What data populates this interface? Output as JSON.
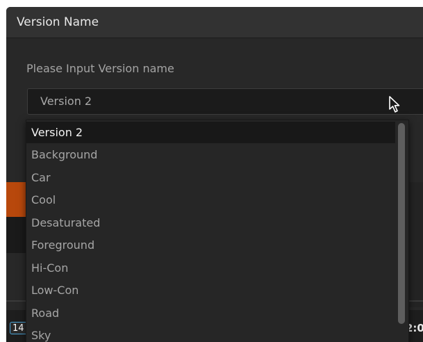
{
  "dialog": {
    "title": "Version Name",
    "prompt": "Please Input Version name",
    "combo_value": "Version 2"
  },
  "dropdown": {
    "items": [
      {
        "label": "Version 2",
        "selected": true
      },
      {
        "label": "Background",
        "selected": false
      },
      {
        "label": "Car",
        "selected": false
      },
      {
        "label": "Cool",
        "selected": false
      },
      {
        "label": "Desaturated",
        "selected": false
      },
      {
        "label": "Foreground",
        "selected": false
      },
      {
        "label": "Hi-Con",
        "selected": false
      },
      {
        "label": "Low-Con",
        "selected": false
      },
      {
        "label": "Road",
        "selected": false
      },
      {
        "label": "Sky",
        "selected": false
      }
    ]
  },
  "background": {
    "timecode_left": "14",
    "timecode_right": "2:0"
  },
  "icons": {
    "cursor": "mouse-pointer-icon"
  },
  "colors": {
    "dialog_bg": "#282828",
    "selected_row": "#181818",
    "accent_orange": "#b8480c",
    "timecode_border": "#4aa4d8"
  }
}
